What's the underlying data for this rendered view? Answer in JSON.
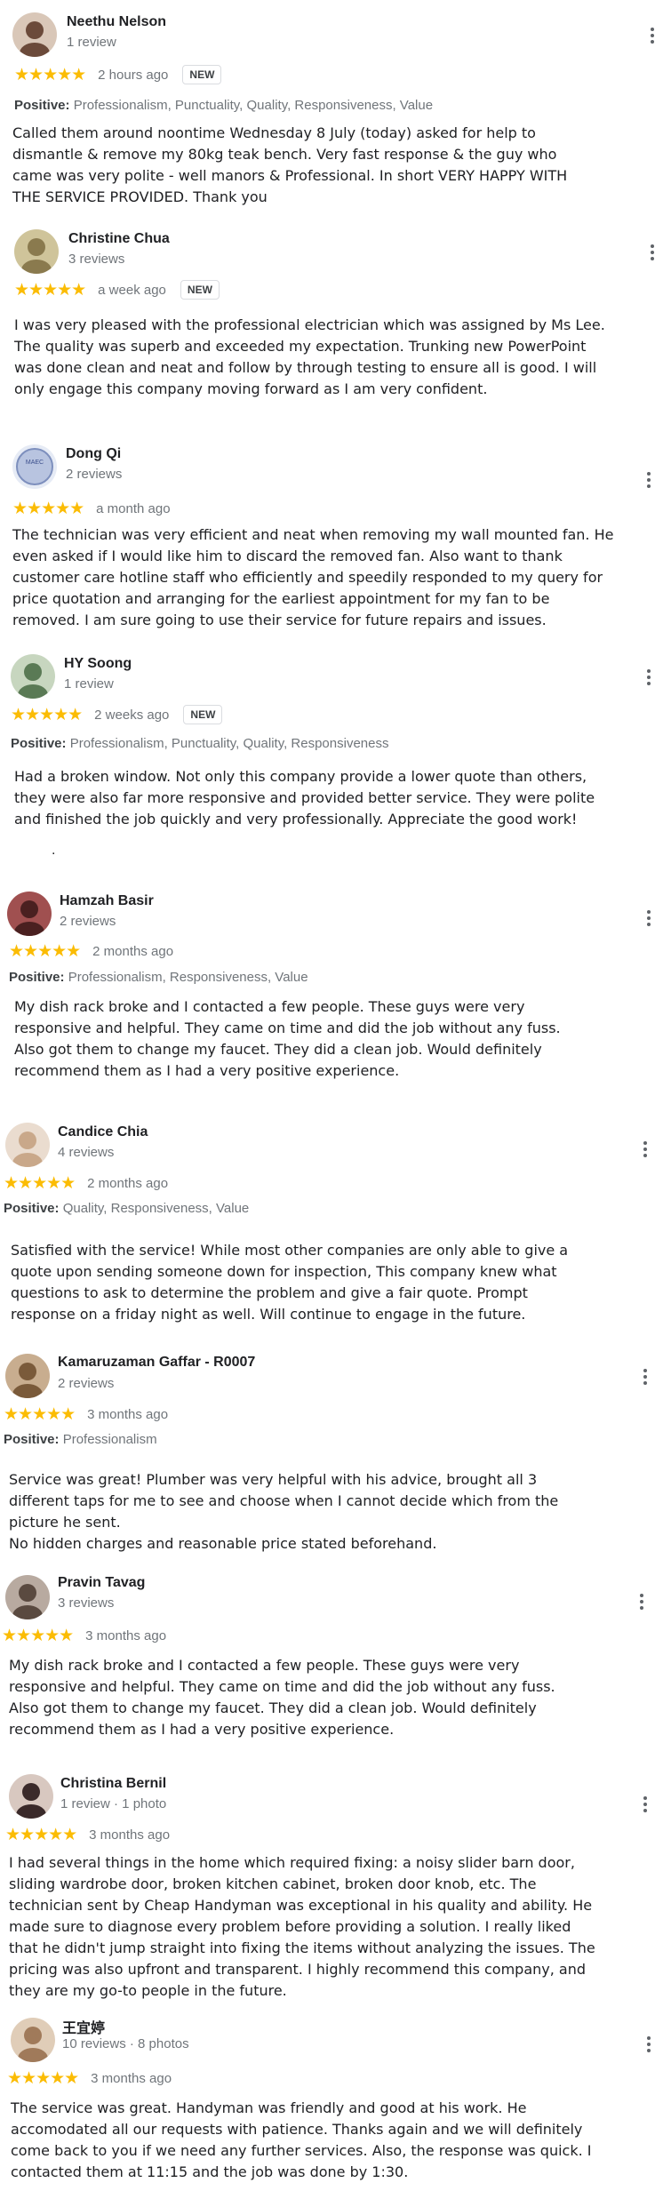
{
  "reviews": [
    {
      "name": "Neethu Nelson",
      "meta": "1 review",
      "stars": "★★★★★",
      "time": "2 hours ago",
      "badge": "NEW",
      "positive_label": "Positive:",
      "positive_values": "Professionalism, Punctuality, Quality, Responsiveness, Value",
      "text": "Called them around noontime Wednesday 8 July (today) asked for help to\ndismantle & remove my 80kg teak bench. Very fast response & the guy who\ncame was very polite - well manors & Professional. In short VERY HAPPY WITH\nTHE SERVICE PROVIDED. Thank you",
      "avatar_color": "#6b4a3a"
    },
    {
      "name": "Christine Chua",
      "meta": "3 reviews",
      "stars": "★★★★★",
      "time": "a week ago",
      "badge": "NEW",
      "text": "I was very pleased with the professional electrician which was assigned by Ms Lee.\nThe quality was superb and exceeded my expectation. Trunking new PowerPoint\nwas done clean and neat and follow by through testing to ensure all is good. I will\nonly engage this company moving forward as I am very confident.",
      "avatar_color": "#8a7a4e"
    },
    {
      "name": "Dong Qi",
      "meta": "2 reviews",
      "stars": "★★★★★",
      "time": "a month ago",
      "text": "The technician was very efficient and neat when removing my wall mounted fan. He\neven asked if I would like him to discard the removed fan. Also want to thank\ncustomer care hotline staff who efficiently and speedily responded to my query for\nprice quotation and arranging for the earliest appointment for my fan to be\nremoved. I am sure going to use their service for future repairs and issues.",
      "avatar_color": "#b8c4e0",
      "avatar_text": "MAEC"
    },
    {
      "name": "HY Soong",
      "meta": "1 review",
      "stars": "★★★★★",
      "time": "2 weeks ago",
      "badge": "NEW",
      "positive_label": "Positive:",
      "positive_values": "Professionalism, Punctuality, Quality, Responsiveness",
      "text": "Had a broken window. Not only this company provide a lower quote than others,\nthey were also far more responsive and provided better service. They were polite\nand finished the job quickly and very professionally. Appreciate the good work!",
      "avatar_color": "#5a7a55"
    },
    {
      "name": "Hamzah Basir",
      "meta": "2 reviews",
      "stars": "★★★★★",
      "time": "2 months ago",
      "positive_label": "Positive:",
      "positive_values": "Professionalism, Responsiveness, Value",
      "text": "My dish rack broke and I contacted a few people. These guys were very\nresponsive and helpful. They came on time and did the job without any fuss.\nAlso got them to change my faucet. They did a clean job. Would definitely\nrecommend them as I had a very positive experience.",
      "avatar_color": "#4a2020"
    },
    {
      "name": "Candice Chia",
      "meta": "4 reviews",
      "stars": "★★★★★",
      "time": "2 months ago",
      "positive_label": "Positive:",
      "positive_values": "Quality, Responsiveness, Value",
      "text": "Satisfied with the service! While most other companies are only able to give a\nquote upon sending someone down for inspection, This company knew what\nquestions to ask to determine the problem and give a fair quote. Prompt\nresponse on a friday night as well. Will continue to engage in the future.",
      "avatar_color": "#c9a88a"
    },
    {
      "name": "Kamaruzaman Gaffar - R0007",
      "meta": "2 reviews",
      "stars": "★★★★★",
      "time": "3 months ago",
      "positive_label": "Positive:",
      "positive_values": "Professionalism",
      "text": "Service was great! Plumber was very helpful with his advice, brought all 3\ndifferent taps for me to see and choose when I cannot decide which from the\npicture he sent.\nNo hidden charges and reasonable price stated beforehand.",
      "avatar_color": "#7a5a3a"
    },
    {
      "name": "Pravin Tavag",
      "meta": "3 reviews",
      "stars": "★★★★★",
      "time": "3 months ago",
      "text": "My dish rack broke and I contacted a few people. These guys were very\nresponsive and helpful. They came on time and did the job without any fuss.\nAlso got them to change my faucet. They did a clean job. Would definitely\nrecommend them as I had a very positive experience.",
      "avatar_color": "#5a4a40"
    },
    {
      "name": "Christina Bernil",
      "meta": "1 review · 1 photo",
      "stars": "★★★★★",
      "time": "3 months ago",
      "text": "I had several things in the home which required fixing: a noisy slider barn door,\nsliding wardrobe door, broken kitchen cabinet, broken door knob, etc. The\ntechnician sent by Cheap Handyman was exceptional in his quality and ability. He\nmade sure to diagnose every problem before providing a solution. I really liked\nthat he didn't jump straight into fixing the items without analyzing the issues. The\npricing was also upfront and transparent. I highly recommend this company, and\nthey are my go-to people in the future.",
      "avatar_color": "#3a2a2a"
    },
    {
      "name": "王宜婷",
      "meta": "10 reviews · 8 photos",
      "stars": "★★★★★",
      "time": "3 months ago",
      "text": "The service was great. Handyman was friendly and good at his work. He\naccomodated all our requests with patience. Thanks again and we will definitely\ncome back to you if we need any further services. Also, the response was quick. I\ncontacted them at 11:15 and the job was done by 1:30.",
      "avatar_color": "#a07a5a"
    }
  ],
  "stray_dot": "."
}
